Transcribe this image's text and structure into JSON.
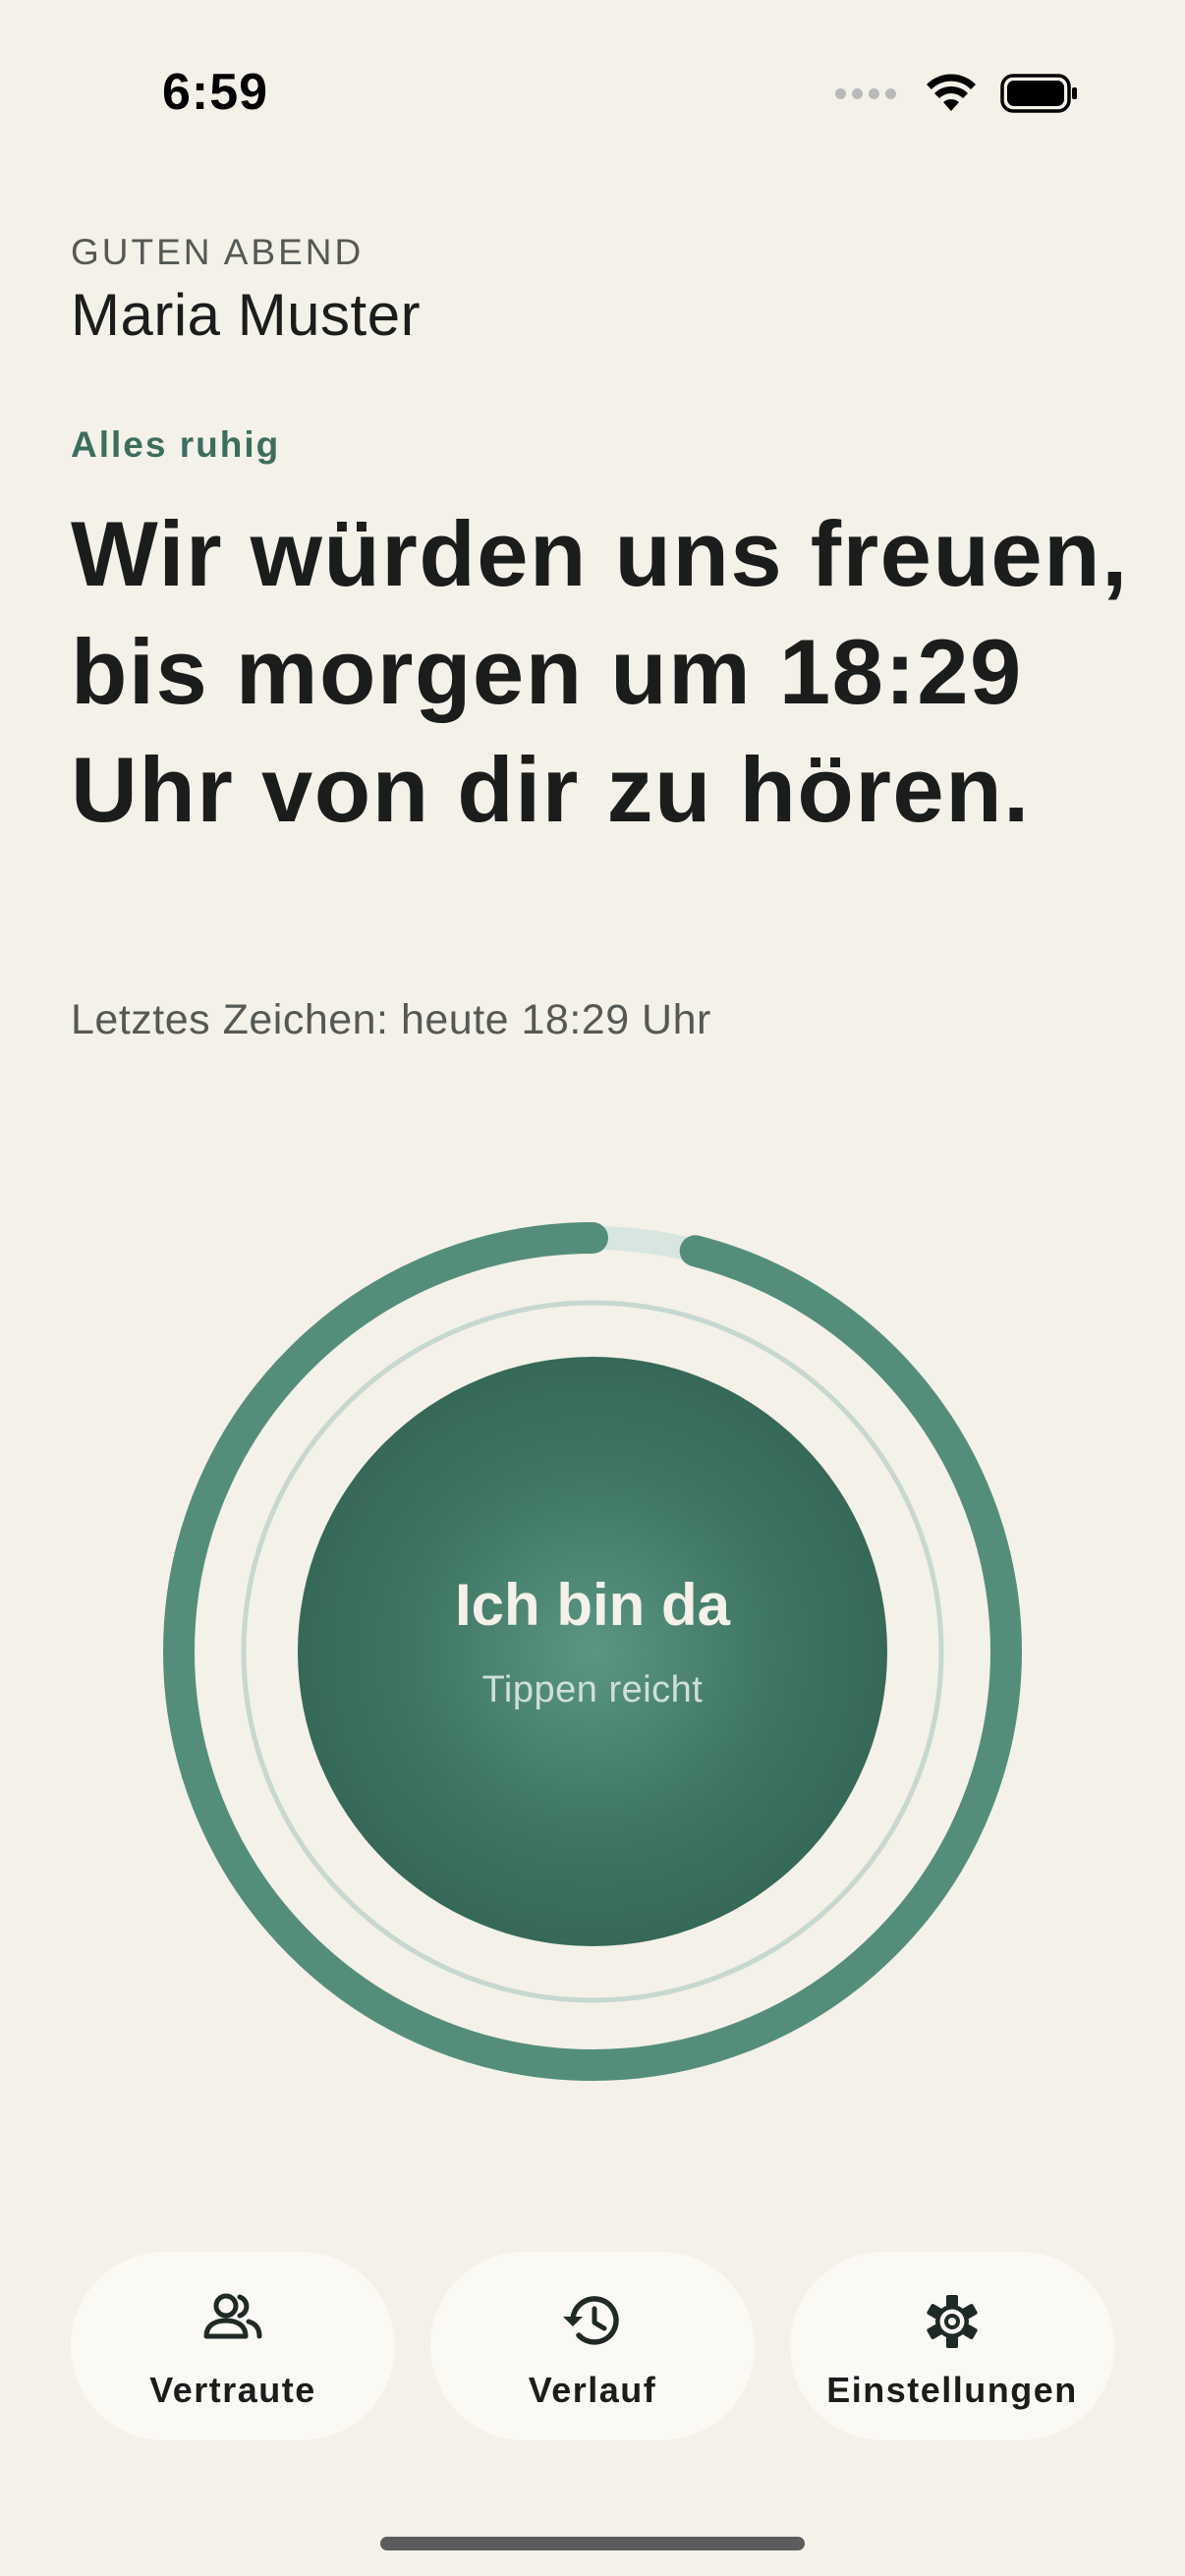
{
  "status_bar": {
    "time": "6:59"
  },
  "header": {
    "greeting": "GUTEN ABEND",
    "name": "Maria Muster"
  },
  "status": {
    "label": "Alles ruhig",
    "headline": "Wir würden uns freuen, bis morgen um 18:29 Uhr von dir zu hören.",
    "last_sign": "Letztes Zeichen: heute 18:29 Uhr"
  },
  "checkin": {
    "title": "Ich bin da",
    "subtitle": "Tippen reicht",
    "progress": 0.96
  },
  "nav": {
    "contacts_label": "Vertraute",
    "history_label": "Verlauf",
    "settings_label": "Einstellungen"
  },
  "colors": {
    "accent": "#548e7b",
    "background": "#f4f1e9",
    "button_dark": "#2e5b4d"
  },
  "icons": {
    "contacts": "people-icon",
    "history": "history-icon",
    "settings": "gear-icon"
  }
}
